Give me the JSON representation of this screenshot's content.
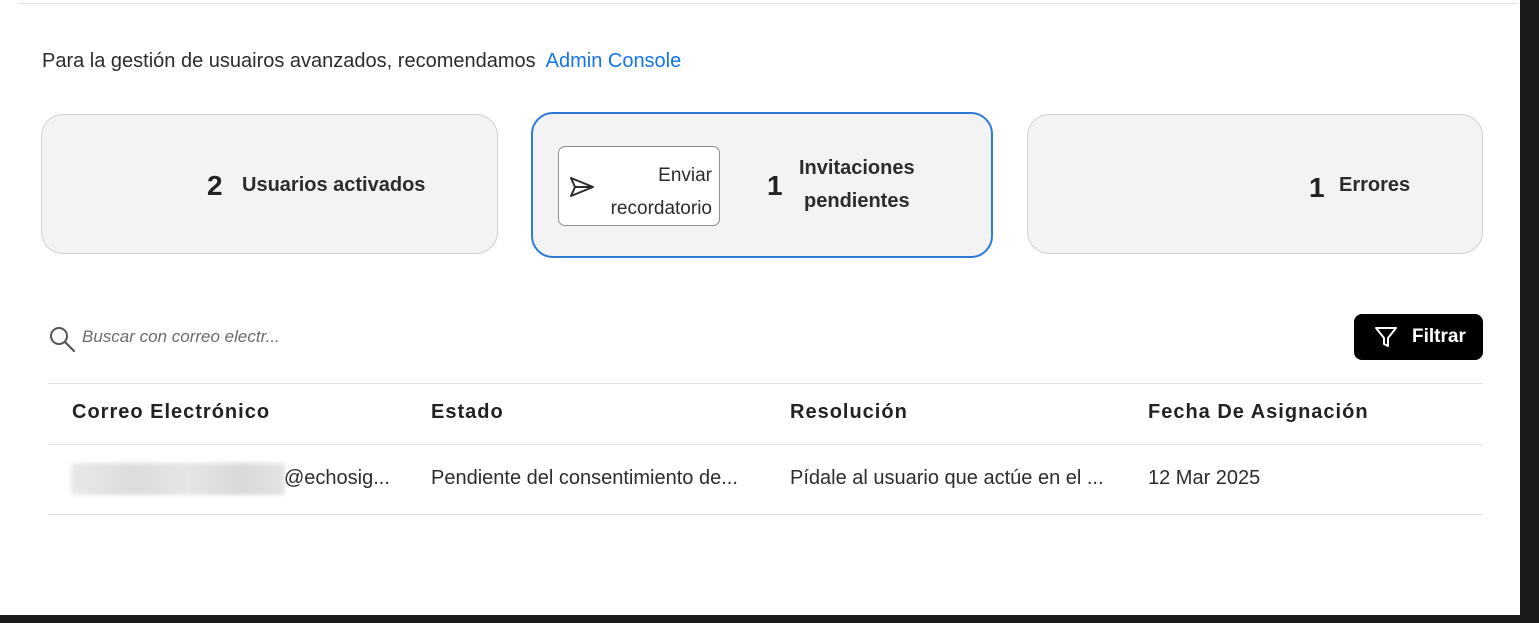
{
  "intro": {
    "text": "Para la gestión de usuairos avanzados, recomendamos",
    "link_label": "Admin Console"
  },
  "cards": {
    "active": {
      "count": "2",
      "label": "Usuarios activados"
    },
    "pending": {
      "button_line1": "Enviar",
      "button_line2": "recordatorio",
      "count": "1",
      "label_line1": "Invitaciones",
      "label_line2": "pendientes"
    },
    "errors": {
      "count": "1",
      "label": "Errores"
    }
  },
  "search": {
    "placeholder": "Buscar con correo electr..."
  },
  "filter": {
    "label": "Filtrar"
  },
  "table": {
    "headers": [
      "Correo Electrónico",
      "Estado",
      "Resolución",
      "Fecha De Asignación"
    ],
    "rows": [
      {
        "email_domain": "@echosig...",
        "status": "Pendiente del consentimiento de...",
        "resolution": "Pídale al usuario que actúe en el ...",
        "date": "12 Mar 2025"
      }
    ]
  },
  "colors": {
    "link": "#1473e6",
    "selected_card_border": "#2c7ad6",
    "card_bg": "#f3f3f3",
    "filter_button_bg": "#000000"
  },
  "icons": {
    "search": "search-icon",
    "send": "send-icon",
    "filter": "funnel-icon"
  }
}
